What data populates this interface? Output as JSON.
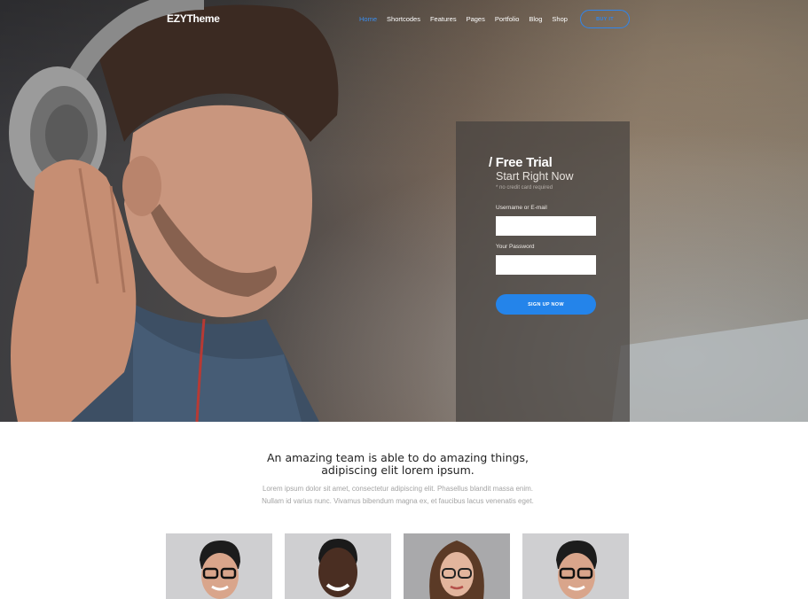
{
  "brand": {
    "logo": "EZYTheme"
  },
  "nav": {
    "items": [
      {
        "label": "Home",
        "active": true
      },
      {
        "label": "Shortcodes",
        "active": false
      },
      {
        "label": "Features",
        "active": false
      },
      {
        "label": "Pages",
        "active": false
      },
      {
        "label": "Portfolio",
        "active": false
      },
      {
        "label": "Blog",
        "active": false
      },
      {
        "label": "Shop",
        "active": false
      }
    ],
    "buy_label": "BUY IT"
  },
  "signup": {
    "title": "/ Free Trial",
    "subtitle": "Start Right Now",
    "note": "* no credit card required",
    "username_label": "Username or E-mail",
    "username_value": "",
    "password_label": "Your Password",
    "password_value": "",
    "button_label": "SIGN UP NOW"
  },
  "intro": {
    "headline_line1": "An amazing team is able to do amazing things,",
    "headline_line2": "adipiscing elit lorem ipsum.",
    "para_line1": "Lorem ipsum dolor sit amet, consectetur adipiscing elit. Phasellus blandit massa enim.",
    "para_line2": "Nullam id varius nunc. Vivamus bibendum magna ex, et faucibus lacus venenatis eget."
  },
  "team": {
    "members": [
      {
        "avatar": "man-glasses-avatar"
      },
      {
        "avatar": "man-smiling-avatar"
      },
      {
        "avatar": "woman-glasses-avatar"
      },
      {
        "avatar": "man-glasses-avatar"
      }
    ]
  },
  "colors": {
    "accent": "#2484ea",
    "nav_active": "#3a8ef0"
  }
}
